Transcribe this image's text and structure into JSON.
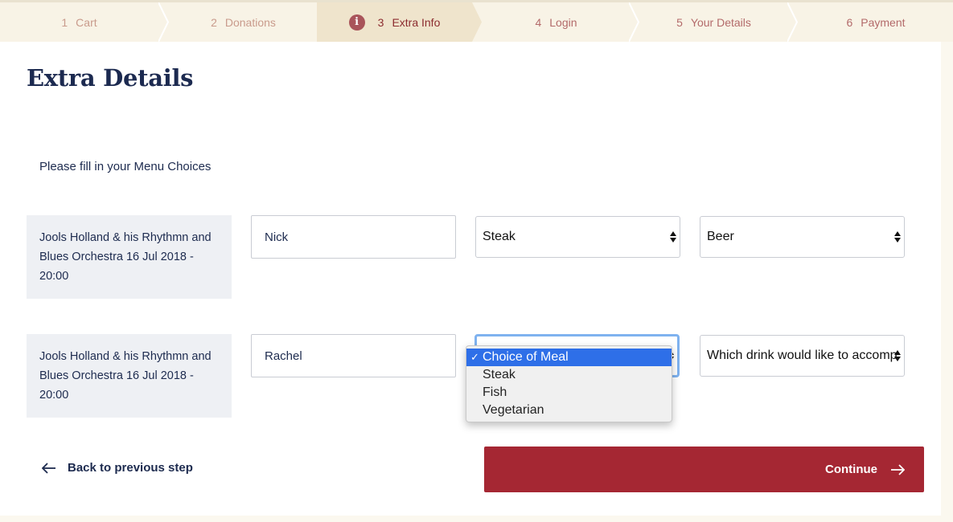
{
  "stepper": {
    "steps": [
      {
        "num": "1",
        "label": "Cart"
      },
      {
        "num": "2",
        "label": "Donations"
      },
      {
        "num": "3",
        "label": "Extra Info"
      },
      {
        "num": "4",
        "label": "Login"
      },
      {
        "num": "5",
        "label": "Your Details"
      },
      {
        "num": "6",
        "label": "Payment"
      }
    ],
    "active_icon": "info-icon"
  },
  "page": {
    "title": "Extra Details",
    "intro": "Please fill in your Menu Choices"
  },
  "rows": [
    {
      "event": "Jools Holland & his Rhythmn and Blues Orchestra 16 Jul 2018 - 20:00",
      "name": "Nick",
      "meal": "Steak",
      "drink": "Beer"
    },
    {
      "event": "Jools Holland & his Rhythmn and Blues Orchestra 16 Jul 2018 - 20:00",
      "name": "Rachel",
      "meal": "",
      "drink": "Which drink would like to accomp"
    }
  ],
  "meal_dropdown": {
    "options": [
      "Choice of Meal",
      "Steak",
      "Fish",
      "Vegetarian"
    ],
    "selected_check": "✓"
  },
  "nav": {
    "back_label": "Back to previous step",
    "continue_label": "Continue"
  },
  "colors": {
    "brand_red": "#a52733",
    "navy": "#1c2a50",
    "stepper_bg": "#f8f3e6",
    "active_step_bg": "#efe4cc"
  }
}
